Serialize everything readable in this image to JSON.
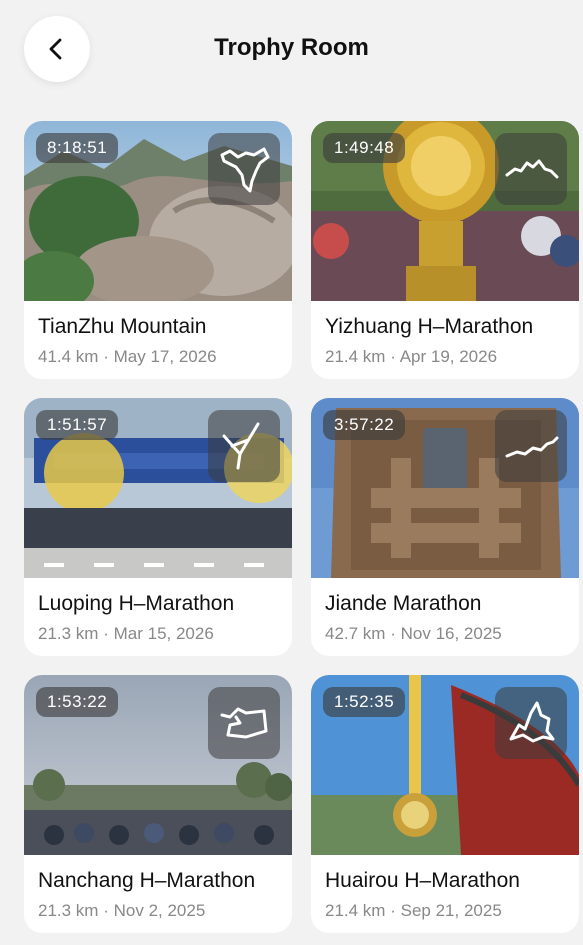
{
  "header": {
    "title": "Trophy Room",
    "back_icon": "chevron-left-icon"
  },
  "trophies": [
    {
      "name": "TianZhu Mountain",
      "distance": "41.4 km",
      "date": "May 17, 2026",
      "time": "8:18:51"
    },
    {
      "name": "Yizhuang H–Marathon",
      "distance": "21.4 km",
      "date": "Apr 19, 2026",
      "time": "1:49:48"
    },
    {
      "name": "Luoping H–Marathon",
      "distance": "21.3 km",
      "date": "Mar 15, 2026",
      "time": "1:51:57"
    },
    {
      "name": "Jiande Marathon",
      "distance": "42.7 km",
      "date": "Nov 16, 2025",
      "time": "3:57:22"
    },
    {
      "name": "Nanchang H–Marathon",
      "distance": "21.3 km",
      "date": "Nov 2, 2025",
      "time": "1:53:22"
    },
    {
      "name": "Huairou H–Marathon",
      "distance": "21.4 km",
      "date": "Sep 21, 2025",
      "time": "1:52:35"
    }
  ],
  "separator": "·"
}
